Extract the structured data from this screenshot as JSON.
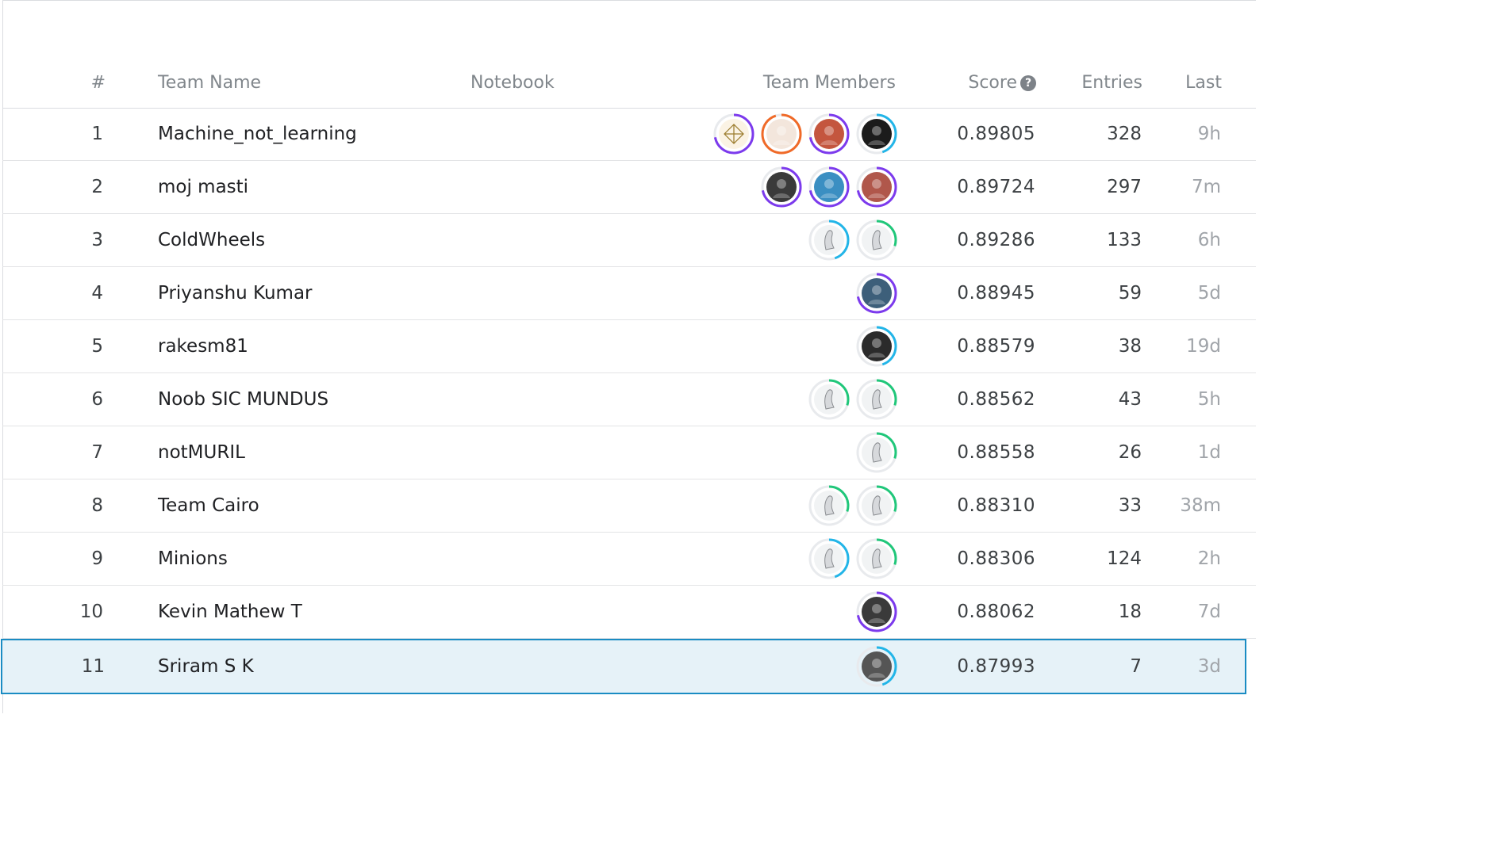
{
  "header": {
    "rank": "#",
    "team_name": "Team Name",
    "notebook": "Notebook",
    "team_members": "Team Members",
    "score": "Score",
    "score_help_icon": "help-circle-icon",
    "entries": "Entries",
    "last": "Last"
  },
  "colors": {
    "highlight_bg": "#e6f2f8",
    "highlight_border": "#1a8cc3",
    "ring_purple": "#7c3aed",
    "ring_orange": "#f06a28",
    "ring_blue": "#22b5e8",
    "ring_green": "#20c77a"
  },
  "rows": [
    {
      "rank": "1",
      "team": "Machine_not_learning",
      "score": "0.89805",
      "entries": "328",
      "last": "9h",
      "members": [
        {
          "icon": "wireframe-avatar",
          "ring": "purple"
        },
        {
          "icon": "cartoon-man-avatar",
          "ring": "orange"
        },
        {
          "icon": "anime-avatar",
          "ring": "purple"
        },
        {
          "icon": "dark-logo-avatar",
          "ring": "blue"
        }
      ]
    },
    {
      "rank": "2",
      "team": "moj masti",
      "score": "0.89724",
      "entries": "297",
      "last": "7m",
      "members": [
        {
          "icon": "photo-avatar",
          "ring": "purple"
        },
        {
          "icon": "photo-avatar",
          "ring": "purple"
        },
        {
          "icon": "photo-avatar",
          "ring": "purple"
        }
      ]
    },
    {
      "rank": "3",
      "team": "ColdWheels",
      "score": "0.89286",
      "entries": "133",
      "last": "6h",
      "members": [
        {
          "icon": "default-goose-avatar",
          "ring": "blue"
        },
        {
          "icon": "default-goose-avatar",
          "ring": "green"
        }
      ]
    },
    {
      "rank": "4",
      "team": "Priyanshu Kumar",
      "score": "0.88945",
      "entries": "59",
      "last": "5d",
      "members": [
        {
          "icon": "cartoon-glasses-avatar",
          "ring": "purple"
        }
      ]
    },
    {
      "rank": "5",
      "team": "rakesm81",
      "score": "0.88579",
      "entries": "38",
      "last": "19d",
      "members": [
        {
          "icon": "silhouette-avatar",
          "ring": "blue"
        }
      ]
    },
    {
      "rank": "6",
      "team": "Noob SIC MUNDUS",
      "score": "0.88562",
      "entries": "43",
      "last": "5h",
      "members": [
        {
          "icon": "default-goose-avatar",
          "ring": "green"
        },
        {
          "icon": "default-goose-avatar",
          "ring": "green"
        }
      ]
    },
    {
      "rank": "7",
      "team": "notMURIL",
      "score": "0.88558",
      "entries": "26",
      "last": "1d",
      "members": [
        {
          "icon": "default-goose-avatar",
          "ring": "green"
        }
      ]
    },
    {
      "rank": "8",
      "team": "Team Cairo",
      "score": "0.88310",
      "entries": "33",
      "last": "38m",
      "members": [
        {
          "icon": "default-goose-avatar",
          "ring": "green"
        },
        {
          "icon": "default-goose-avatar",
          "ring": "green"
        }
      ]
    },
    {
      "rank": "9",
      "team": "Minions",
      "score": "0.88306",
      "entries": "124",
      "last": "2h",
      "members": [
        {
          "icon": "default-goose-avatar",
          "ring": "blue"
        },
        {
          "icon": "default-goose-avatar",
          "ring": "green"
        }
      ]
    },
    {
      "rank": "10",
      "team": "Kevin Mathew T",
      "score": "0.88062",
      "entries": "18",
      "last": "7d",
      "members": [
        {
          "icon": "photo-avatar",
          "ring": "purple"
        }
      ]
    },
    {
      "rank": "11",
      "team": "Sriram S K",
      "score": "0.87993",
      "entries": "7",
      "last": "3d",
      "members": [
        {
          "icon": "bw-photo-avatar",
          "ring": "blue"
        }
      ],
      "highlighted": true
    }
  ]
}
